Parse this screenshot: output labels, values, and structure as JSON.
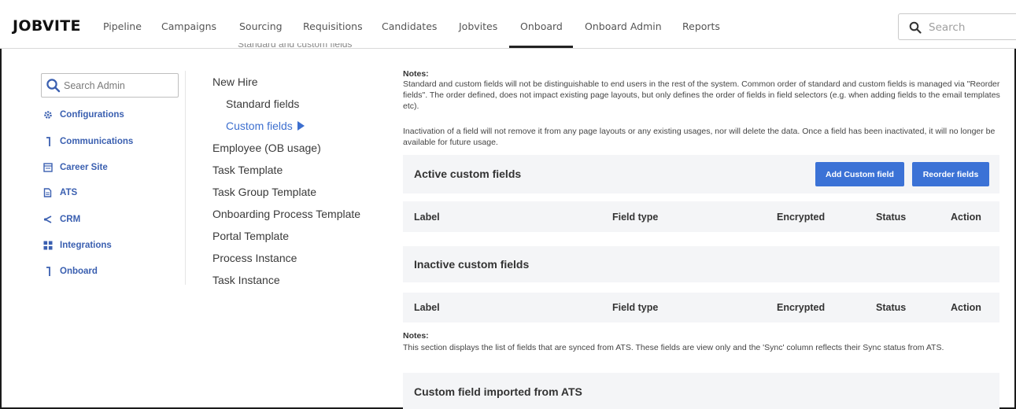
{
  "app": {
    "logo": "JOBVITE"
  },
  "topnav": {
    "items": [
      "Pipeline",
      "Campaigns",
      "Sourcing",
      "Requisitions",
      "Candidates",
      "Jobvites",
      "Onboard",
      "Onboard Admin",
      "Reports"
    ],
    "active": "Onboard",
    "search_placeholder": "Search"
  },
  "breadcrumb_remnant": "Standard and custom fields",
  "admin_sidebar": {
    "search_placeholder": "Search Admin",
    "items": [
      {
        "label": "Configurations",
        "icon": "gear-icon"
      },
      {
        "label": "Communications",
        "icon": "bracket-icon"
      },
      {
        "label": "Career Site",
        "icon": "browser-icon"
      },
      {
        "label": "ATS",
        "icon": "document-icon"
      },
      {
        "label": "CRM",
        "icon": "share-icon"
      },
      {
        "label": "Integrations",
        "icon": "grid-icon"
      },
      {
        "label": "Onboard",
        "icon": "bracket-icon"
      }
    ]
  },
  "tree": {
    "items": [
      {
        "label": "New Hire",
        "level": 0
      },
      {
        "label": "Standard fields",
        "level": 1
      },
      {
        "label": "Custom fields",
        "level": 1,
        "active": true
      },
      {
        "label": "Employee (OB usage)",
        "level": 0
      },
      {
        "label": "Task Template",
        "level": 0
      },
      {
        "label": "Task Group Template",
        "level": 0
      },
      {
        "label": "Onboarding Process Template",
        "level": 0
      },
      {
        "label": "Portal Template",
        "level": 0
      },
      {
        "label": "Process Instance",
        "level": 0
      },
      {
        "label": "Task Instance",
        "level": 0
      }
    ]
  },
  "main": {
    "notes1": {
      "title": "Notes:",
      "para1": "Standard and custom fields will not be distinguishable to end users in the rest of the system. Common order of standard and custom fields is managed via \"Reorder fields\". The order defined, does not impact existing page layouts, but only defines the order of fields in field selectors (e.g. when adding fields to the email templates etc).",
      "para2": "Inactivation of a field will not remove it from any page layouts or any existing usages, nor will delete the data. Once a field has been inactivated, it will no longer be available for future usage."
    },
    "active_section": {
      "title": "Active custom fields",
      "add_button": "Add Custom field",
      "reorder_button": "Reorder fields"
    },
    "columns": [
      "Label",
      "Field type",
      "Encrypted",
      "Status",
      "Action"
    ],
    "inactive_section": {
      "title": "Inactive custom fields"
    },
    "notes2": {
      "title": "Notes:",
      "text": "This section displays the list of fields that are synced from ATS. These fields are view only and the 'Sync' column reflects their Sync status from ATS."
    },
    "imported_section": {
      "title": "Custom field imported from ATS"
    }
  },
  "colors": {
    "accent": "#3b72d6",
    "sidebar_link": "#3a5fb0",
    "panel_bg": "#f4f5f7"
  }
}
